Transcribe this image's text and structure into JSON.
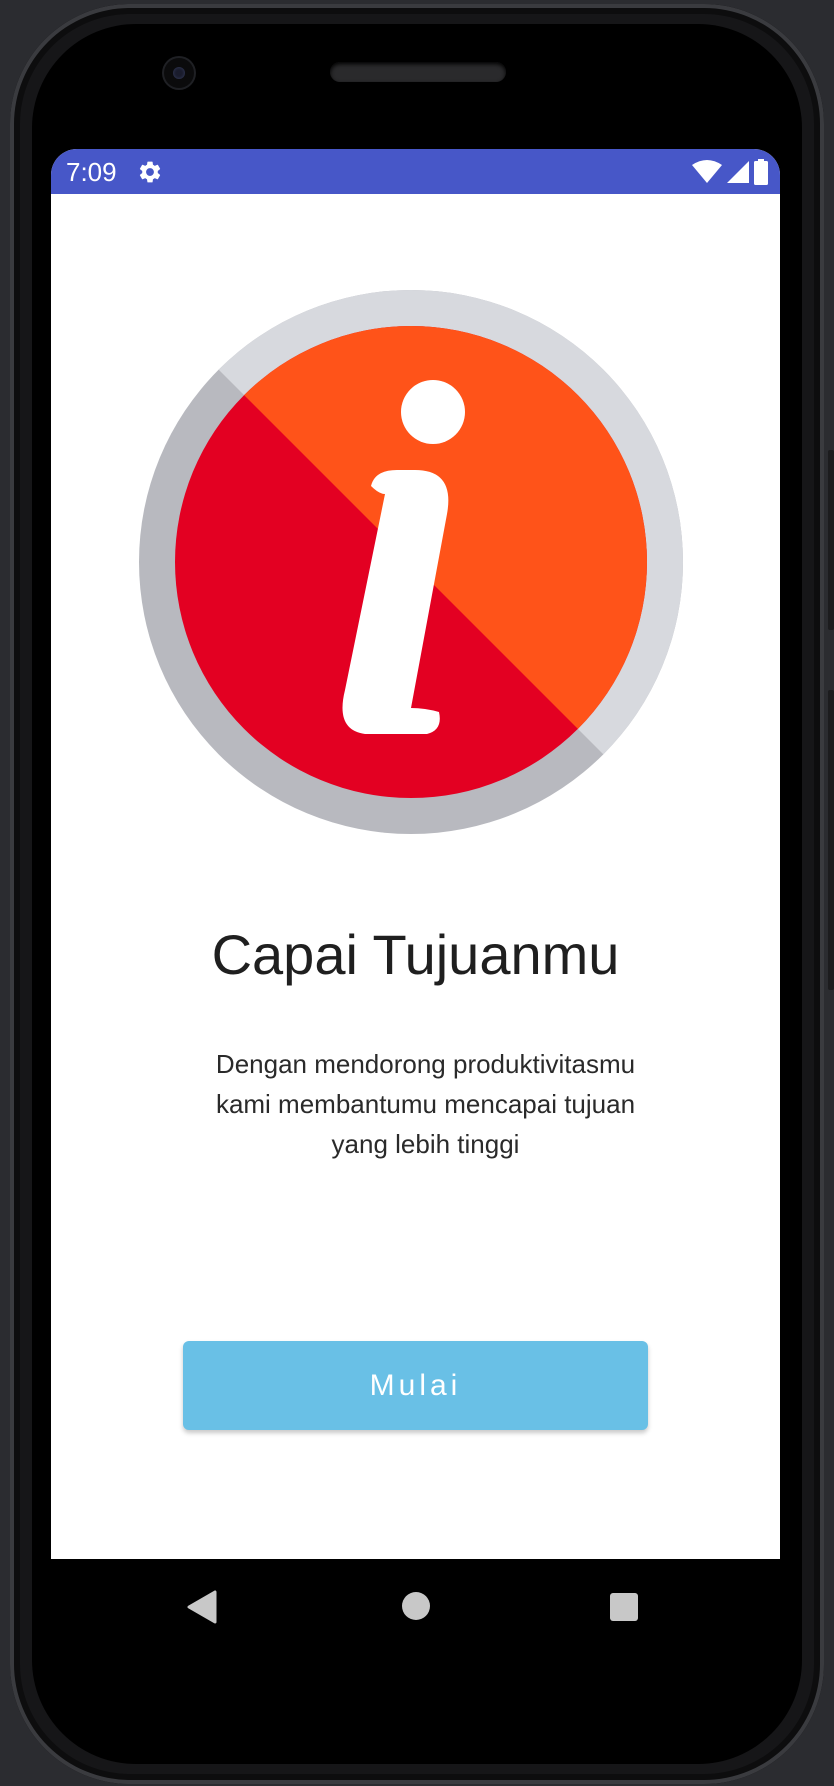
{
  "status_bar": {
    "time": "7:09",
    "background_color": "#4757c8",
    "icons": [
      "gear-icon",
      "wifi-icon",
      "cell-signal-icon",
      "battery-icon"
    ]
  },
  "hero": {
    "icon": "info-icon",
    "colors": {
      "ring_light": "#d7d9de",
      "ring_dark": "#b8b9bf",
      "upper": "#ff5319",
      "lower": "#e30022"
    }
  },
  "content": {
    "title": "Capai Tujuanmu",
    "description": "Dengan mendorong produktivitasmu kami membantumu mencapai tujuan yang lebih tinggi"
  },
  "actions": {
    "start_label": "Mulai",
    "button_color": "#69c0e6"
  },
  "nav_bar": {
    "icons": [
      "back-icon",
      "home-icon",
      "recents-icon"
    ]
  }
}
